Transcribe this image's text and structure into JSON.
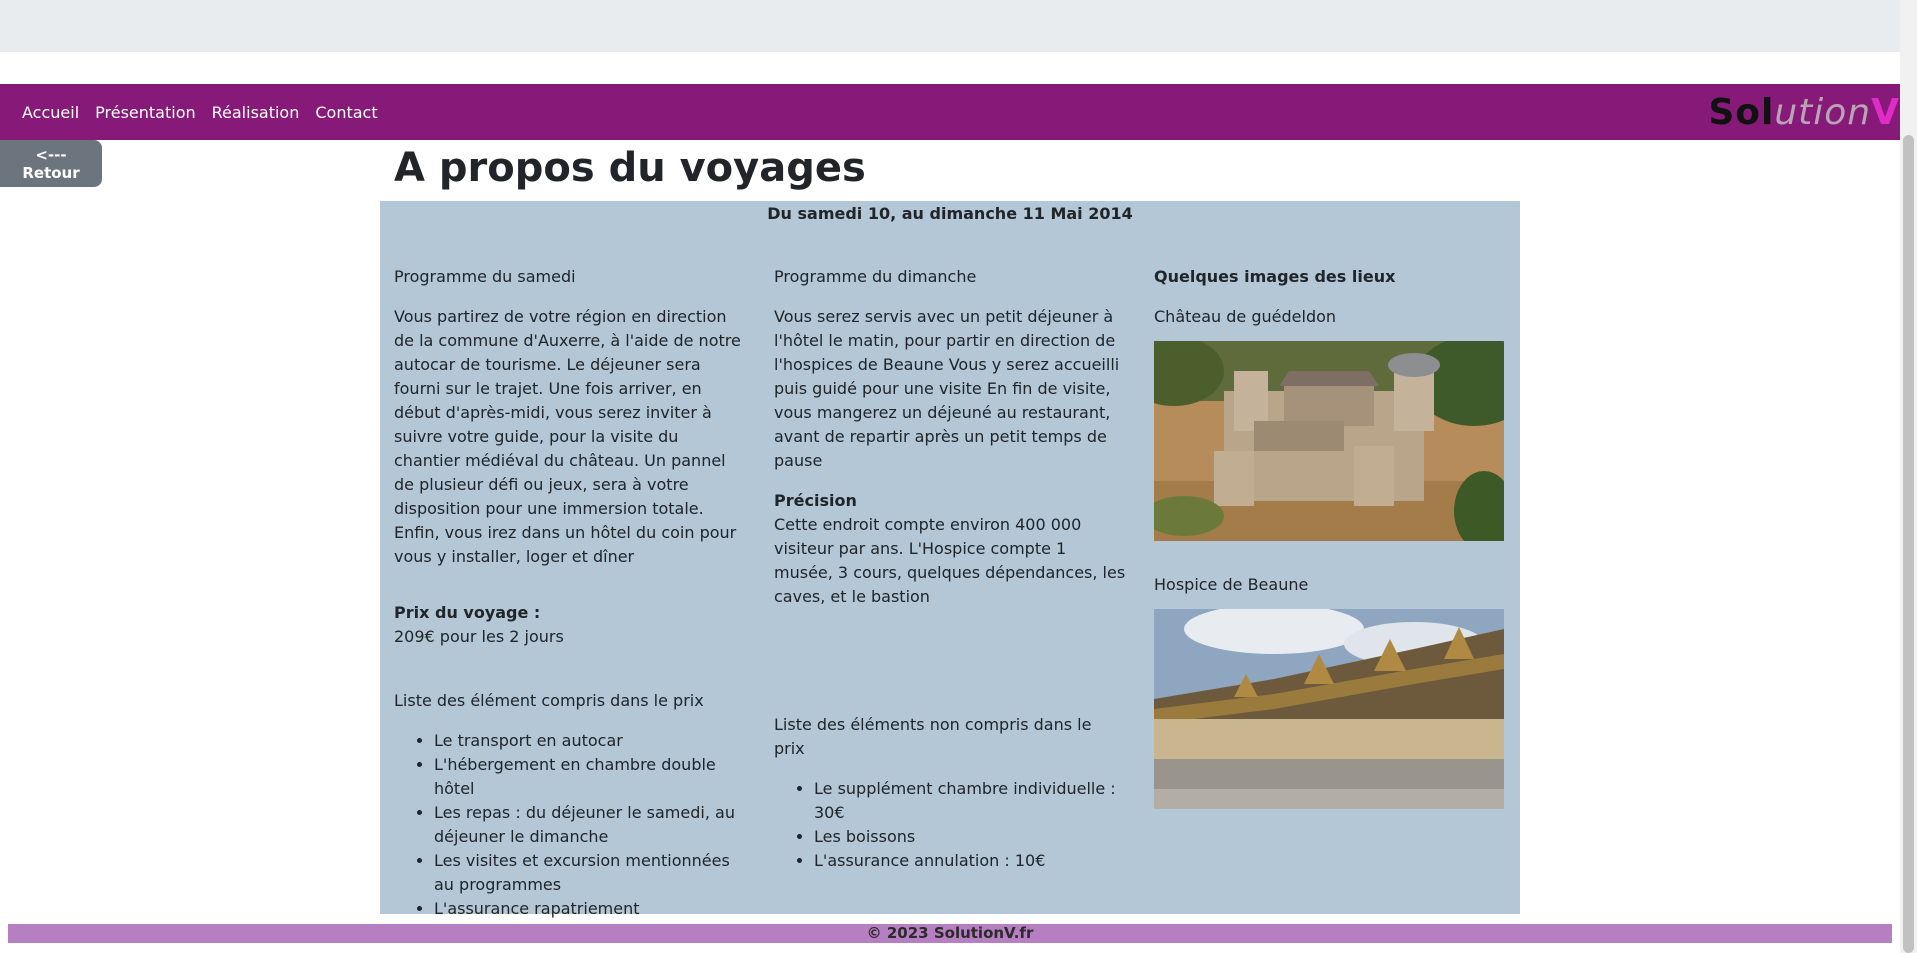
{
  "nav": {
    "links": [
      "Accueil",
      "Présentation",
      "Réalisation",
      "Contact"
    ],
    "logo": {
      "part1": "Sol",
      "part2": "ution",
      "part3": "V"
    }
  },
  "back_button": "<--- Retour",
  "title": "A propos du voyages",
  "date_range": "Du samedi 10, au dimanche 11 Mai 2014",
  "col1": {
    "heading": "Programme du samedi",
    "text": "Vous partirez de votre région en direction de la commune d'Auxerre, à l'aide de notre autocar de tourisme. Le déjeuner sera fourni sur le trajet. Une fois arriver, en début d'après-midi, vous serez inviter à suivre votre guide, pour la visite du chantier médiéval du château. Un pannel de plusieur défi ou jeux, sera à votre disposition pour une immersion totale. Enfin, vous irez dans un hôtel du coin pour vous y installer, loger et dîner",
    "price_label": "Prix du voyage :",
    "price_value": "209€ pour les 2 jours",
    "list_heading": "Liste des élément compris dans le prix",
    "list": [
      "Le transport en autocar",
      "L'hébergement en chambre double hôtel",
      "Les repas : du déjeuner le samedi, au déjeuner le dimanche",
      "Les visites et excursion mentionnées au programmes",
      "L'assurance rapatriement"
    ]
  },
  "col2": {
    "heading": "Programme du dimanche",
    "text": "Vous serez servis avec un petit déjeuner à l'hôtel le matin, pour partir en direction de l'hospices de Beaune Vous y serez accueilli puis guidé pour une visite En fin de visite, vous mangerez un déjeuné au restaurant, avant de repartir après un petit temps de pause",
    "precision_label": "Précision",
    "precision_text": "Cette endroit compte environ 400 000 visiteur par ans. L'Hospice compte 1 musée, 3 cours, quelques dépendances, les caves, et le bastion",
    "list_heading": "Liste des éléments non compris dans le prix",
    "list": [
      "Le supplément chambre individuelle : 30€",
      "Les boissons",
      "L'assurance annulation : 10€"
    ]
  },
  "col3": {
    "heading": "Quelques images des lieux",
    "image1_caption": "Château de guédeldon",
    "image2_caption": "Hospice de Beaune"
  },
  "footer": "© 2023 SolutionV.fr",
  "colors": {
    "navbar": "#871a78",
    "card": "#b3c7d6",
    "footer": "#b57fc1",
    "back_button": "#6c757d"
  }
}
